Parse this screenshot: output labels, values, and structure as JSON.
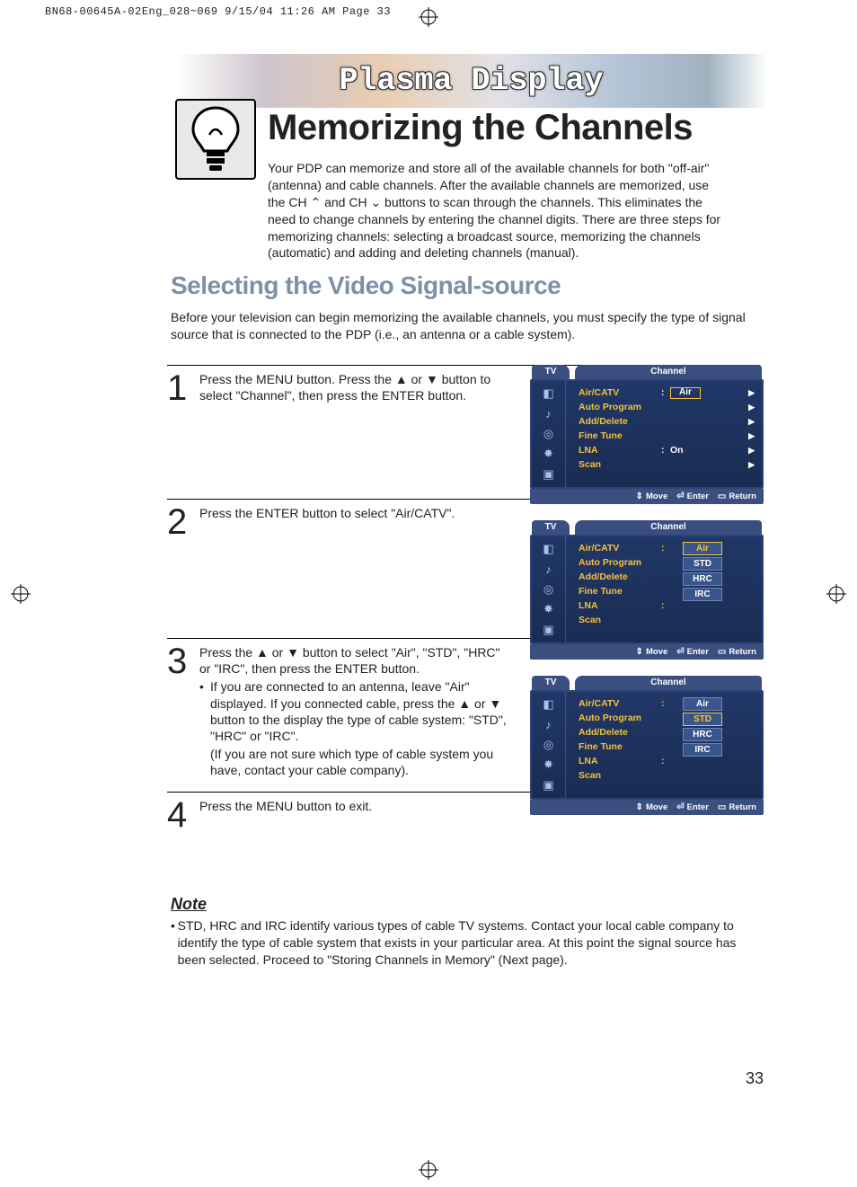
{
  "print_header": "BN68-00645A-02Eng_028~069  9/15/04  11:26 AM  Page 33",
  "banner": "Plasma Display",
  "title": "Memorizing the Channels",
  "intro": "Your PDP can memorize and store all of the available channels for both \"off-air\" (antenna) and cable channels. After the available channels are memorized, use the CH ⌃ and CH ⌄ buttons to scan through the channels. This eliminates the need to change channels by entering the channel digits. There are three steps for memorizing channels: selecting a broadcast source, memorizing the channels (automatic) and adding and deleting channels (manual).",
  "section_title": "Selecting the Video Signal-source",
  "section_intro": "Before your television can begin memorizing the available channels, you must specify the type of signal source that is connected to the PDP (i.e., an antenna or a cable system).",
  "steps": {
    "s1": {
      "num": "1",
      "text": "Press the MENU button. Press the ▲ or ▼ button to select \"Channel\", then press the ENTER button."
    },
    "s2": {
      "num": "2",
      "text": "Press the ENTER button to select \"Air/CATV\"."
    },
    "s3": {
      "num": "3",
      "line1": "Press the ▲ or ▼ button to select  \"Air\", \"STD\", \"HRC\" or \"IRC\", then press the ENTER button.",
      "b1": "If you are connected to an antenna, leave \"Air\" displayed. If you connected cable, press the ▲ or ▼ button to the display the type of cable system: \"STD\", \"HRC\" or \"IRC\".",
      "b2": "(If you are not sure which type of cable system you have, contact your cable company)."
    },
    "s4": {
      "num": "4",
      "text": "Press the MENU button to exit."
    }
  },
  "note_title": "Note",
  "note_body": "STD, HRC and IRC identify various types of cable TV systems. Contact your local cable company to identify the type of cable system that exists in your particular area. At this point the signal source has been selected. Proceed to \"Storing Channels in Memory\" (Next page).",
  "page_num": "33",
  "osd": {
    "tv": "TV",
    "channel": "Channel",
    "menu": {
      "air_catv": "Air/CATV",
      "auto_program": "Auto Program",
      "add_delete": "Add/Delete",
      "fine_tune": "Fine Tune",
      "lna": "LNA",
      "scan": "Scan"
    },
    "vals": {
      "air": "Air",
      "on": "On"
    },
    "opts": {
      "air": "Air",
      "std": "STD",
      "hrc": "HRC",
      "irc": "IRC"
    },
    "footer": {
      "move": "Move",
      "enter": "Enter",
      "return": "Return"
    }
  }
}
